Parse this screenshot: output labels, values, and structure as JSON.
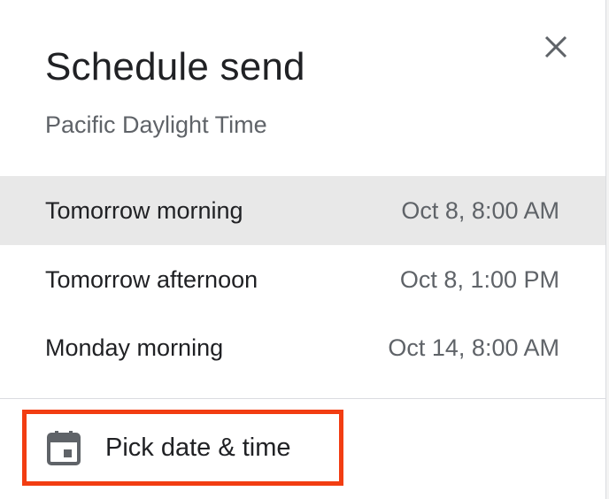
{
  "dialog": {
    "title": "Schedule send",
    "timezone": "Pacific Daylight Time",
    "close_icon": "close-icon"
  },
  "options": [
    {
      "label": "Tomorrow morning",
      "time": "Oct 8, 8:00 AM"
    },
    {
      "label": "Tomorrow afternoon",
      "time": "Oct 8, 1:00 PM"
    },
    {
      "label": "Monday morning",
      "time": "Oct 14, 8:00 AM"
    }
  ],
  "pick": {
    "label": "Pick date & time",
    "icon": "calendar-icon",
    "highlight_color": "#f23d12"
  },
  "colors": {
    "text_primary": "#202124",
    "text_secondary": "#5f6368",
    "hover_row": "#e8e8e8"
  }
}
